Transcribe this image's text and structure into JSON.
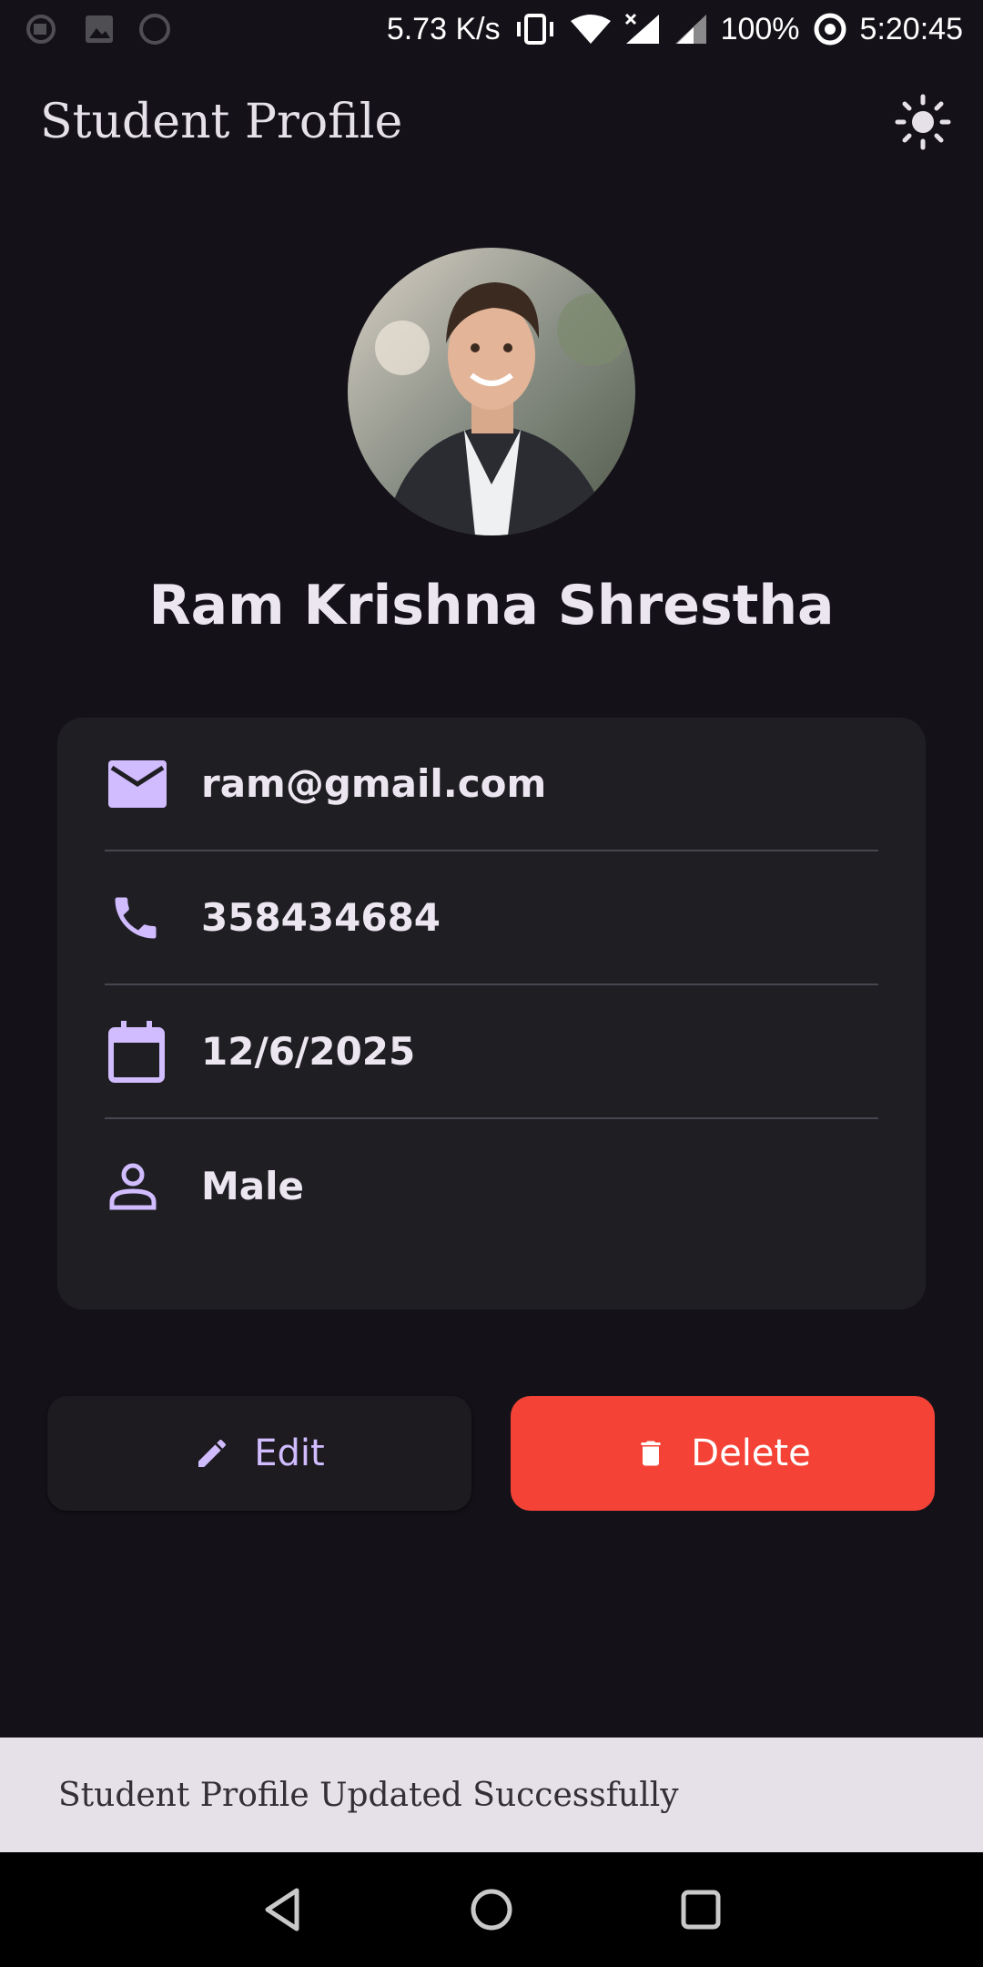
{
  "status_bar": {
    "net_speed": "5.73 K/s",
    "battery": "100%",
    "time": "5:20:45"
  },
  "app_bar": {
    "title": "Student Profile",
    "theme_icon": "sun-icon"
  },
  "profile": {
    "name": "Ram Krishna Shrestha",
    "avatar_icon": "profile-photo"
  },
  "details": [
    {
      "icon": "email-icon",
      "value": "ram@gmail.com"
    },
    {
      "icon": "phone-icon",
      "value": "358434684"
    },
    {
      "icon": "calendar-icon",
      "value": "12/6/2025"
    },
    {
      "icon": "person-icon",
      "value": "Male"
    }
  ],
  "actions": {
    "edit_label": "Edit",
    "delete_label": "Delete"
  },
  "snackbar": {
    "message": "Student Profile Updated Successfully"
  },
  "colors": {
    "background": "#141218",
    "accent": "#d0bcff",
    "danger": "#f44336",
    "card": "#1f1e23"
  }
}
